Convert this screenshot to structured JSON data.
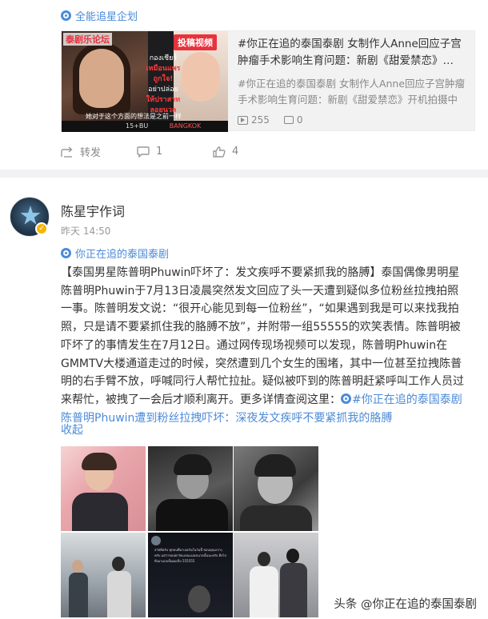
{
  "top_topic": "全能追星企划",
  "share_card": {
    "thumb_logo": "泰剧乐论坛",
    "thumb_badge": "投稿视频",
    "thumb_thai_lines": [
      "กองเชียร์",
      "เหมือนแพร",
      "ถูกใจ!",
      "อย่าปล่อย",
      "ให้ปราสาทลอยนวล"
    ],
    "thumb_caption": "她对于这个方面的想法是之前一样",
    "thumb_bottom": [
      "15+BU",
      "BANGKOK"
    ],
    "title": "#你正在追的泰国泰剧 女制作人Anne回应子宫肿瘤手术影响生育问题：新剧《甜爱禁恋》…",
    "desc": "#你正在追的泰国泰剧 女制作人Anne回应子宫肿瘤手术影响生育问题：新剧《甜爱禁恋》开机拍摄中",
    "plays": "255",
    "comments": "0"
  },
  "actions": {
    "share_label": "转发",
    "comment_count": "1",
    "like_count": "4"
  },
  "post": {
    "author": "陈星宇作词",
    "time": "昨天 14:50",
    "topic": "你正在追的泰国泰剧",
    "body_lines": [
      "【泰国男星陈普明Phuwin吓坏了：发文疾呼不要紧抓我的胳膊】泰国偶像男明星",
      "陈普明Phuwin于7月13日凌晨突然发文回应了头一天遭到疑似多位粉丝拉拽拍照",
      "一事。陈普明发文说：“很开心能见到每一位粉丝”，“如果遇到我是可以来找我拍",
      "照，只是请不要紧抓住我的胳膊不放”，并附带一组55555的欢笑表情。陈普明被",
      "吓坏了的事情发生在7月12日。通过网传现场视频可以发现，陈普明Phuwin在",
      "GMMTV大楼通道走过的时候，突然遭到几个女生的围堵，其中一位甚至拉拽陈普",
      "明的右手臂不放，呼喊同行人帮忙拉扯。疑似被吓到的陈普明赶紧呼叫工作人员过",
      "来帮忙，被拽了一会后才顺利离开。更多详情查阅这里："
    ],
    "body_link_1": "#你正在追的泰国泰剧",
    "body_link_2": "陈普明Phuwin遭到粉丝拉拽吓坏：深夜发文疾呼不要紧抓我的胳膊",
    "collapse": "收起"
  },
  "watermark": "头条 @你正在追的泰国泰剧",
  "colors": {
    "link_orange": "#eb7350",
    "link_blue": "#4b8ad8",
    "badge_red": "#e8323c",
    "verify_gold": "#f7b500"
  },
  "icons": [
    "topic-icon",
    "play-icon",
    "comment-icon",
    "repost-icon",
    "like-icon",
    "verified-icon"
  ]
}
